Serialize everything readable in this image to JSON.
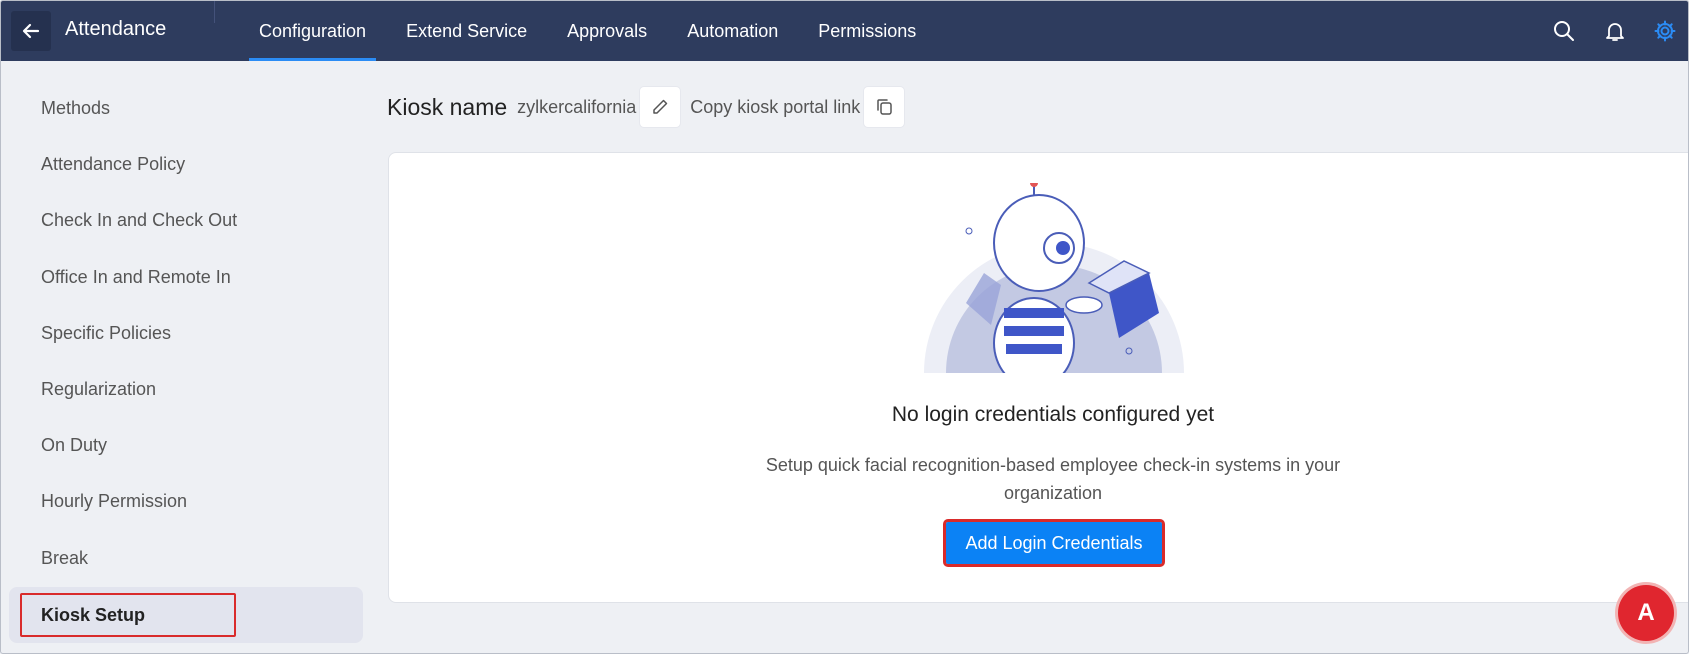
{
  "header": {
    "back_icon": "arrow-left-icon",
    "app_title": "Attendance",
    "tabs": [
      {
        "label": "Configuration",
        "active": true
      },
      {
        "label": "Extend Service",
        "active": false
      },
      {
        "label": "Approvals",
        "active": false
      },
      {
        "label": "Automation",
        "active": false
      },
      {
        "label": "Permissions",
        "active": false
      }
    ],
    "icons": [
      "search-icon",
      "bell-icon",
      "gear-icon"
    ]
  },
  "sidebar": {
    "items": [
      {
        "label": "Methods"
      },
      {
        "label": "Attendance Policy"
      },
      {
        "label": "Check In and Check Out"
      },
      {
        "label": "Office In and Remote In"
      },
      {
        "label": "Specific Policies"
      },
      {
        "label": "Regularization"
      },
      {
        "label": "On Duty"
      },
      {
        "label": "Hourly Permission"
      },
      {
        "label": "Break"
      },
      {
        "label": "Kiosk Setup",
        "active": true
      }
    ]
  },
  "kiosk": {
    "name_label": "Kiosk name",
    "name_value": "zylkercalifornia",
    "copy_link_label": "Copy kiosk portal link"
  },
  "empty_state": {
    "title": "No login credentials configured yet",
    "description": "Setup quick facial recognition-based employee check-in systems in your organization",
    "button_label": "Add Login Credentials"
  },
  "avatar": {
    "initial": "A"
  },
  "colors": {
    "topbar": "#2e3c5e",
    "accent": "#0b82f5",
    "highlight": "#d92b2b",
    "avatar": "#e0262f"
  }
}
